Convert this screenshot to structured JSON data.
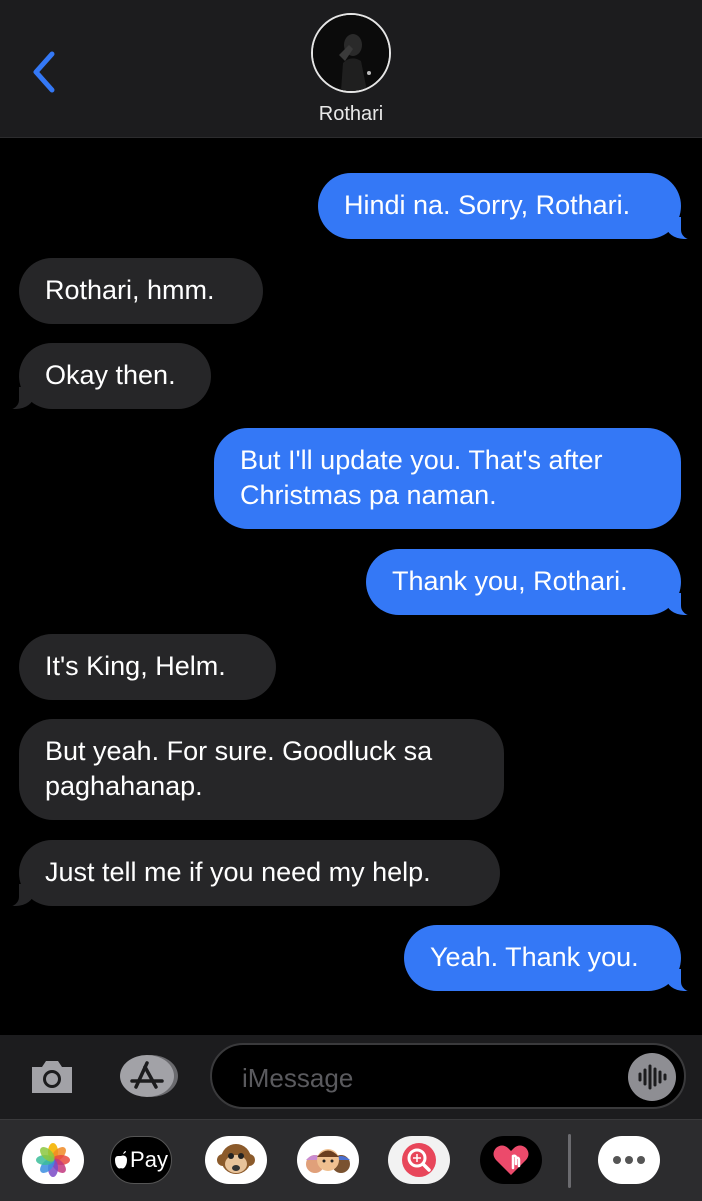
{
  "header": {
    "contact_name": "Rothari"
  },
  "messages": [
    {
      "side": "sent",
      "text": "Hindi na. Sorry, Rothari."
    },
    {
      "side": "received",
      "text": "Rothari, hmm."
    },
    {
      "side": "received",
      "text": "Okay then."
    },
    {
      "side": "sent",
      "lines": [
        "But I'll update you. That's after",
        "Christmas pa naman."
      ]
    },
    {
      "side": "sent",
      "text": "Thank you, Rothari."
    },
    {
      "side": "received",
      "text": "It's King, Helm."
    },
    {
      "side": "received",
      "lines": [
        "But yeah. For sure. Goodluck sa",
        "paghahanap."
      ]
    },
    {
      "side": "received",
      "text": "Just tell me if you need my help."
    },
    {
      "side": "sent",
      "text": "Yeah. Thank you."
    }
  ],
  "input_bar": {
    "placeholder": "iMessage"
  },
  "drawer": {
    "apple_pay_label": "Pay",
    "apps": [
      "photos-app",
      "apple-pay-app",
      "monkey-animoji-app",
      "memoji-stickers-app",
      "image-search-app",
      "digital-touch-app",
      "more-apps"
    ]
  },
  "colors": {
    "sent_bubble": "#3478f6",
    "received_bubble": "#262628",
    "accent": "#3478f6"
  }
}
